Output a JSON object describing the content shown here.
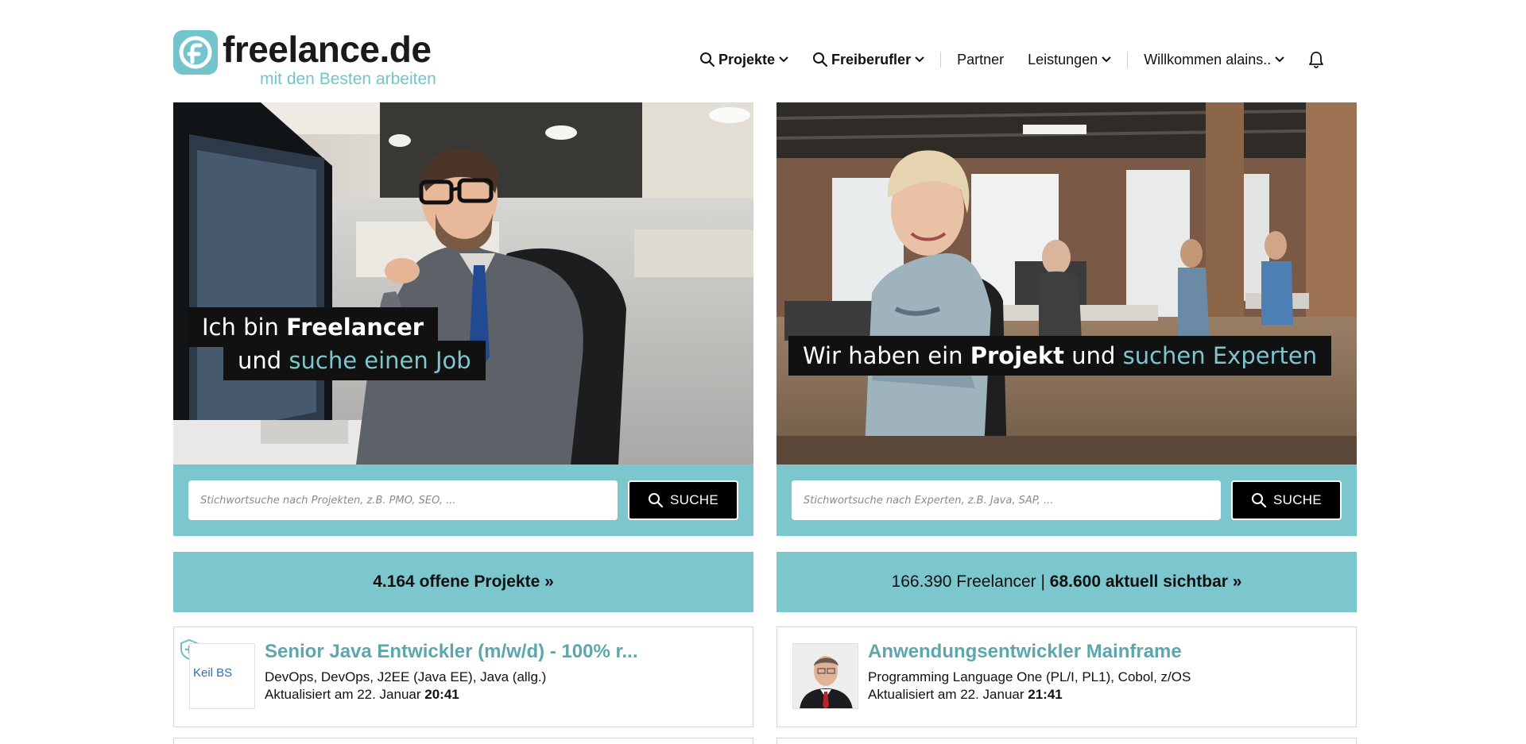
{
  "logo": {
    "name": "freelance.de",
    "tagline": "mit den Besten arbeiten"
  },
  "nav": {
    "projekte": "Projekte",
    "freiberufler": "Freiberufler",
    "partner": "Partner",
    "leistungen": "Leistungen",
    "user": "Willkommen alains.."
  },
  "left_panel": {
    "caption_line1_prefix": "Ich bin ",
    "caption_line1_bold": "Freelancer",
    "caption_line2_prefix": "und ",
    "caption_line2_accent": "suche einen Job",
    "search_placeholder": "Stichwortsuche nach Projekten, z.B. PMO, SEO, ...",
    "search_button": "SUCHE",
    "cta": "4.164 offene Projekte »"
  },
  "right_panel": {
    "caption_prefix": "Wir haben ein ",
    "caption_bold": "Projekt",
    "caption_mid": " und ",
    "caption_accent": "suchen Experten",
    "search_placeholder": "Stichwortsuche nach Experten, z.B. Java, SAP, ...",
    "search_button": "SUCHE",
    "cta_prefix": "166.390 Freelancer | ",
    "cta_bold": "68.600 aktuell sichtbar »"
  },
  "listings": {
    "left": {
      "title": "Senior Java Entwickler (m/w/d) - 100% r...",
      "skills": "DevOps, DevOps, J2EE (Java EE), Java (allg.)",
      "updated_prefix": "Aktualisiert am 22. Januar ",
      "updated_time": "20:41",
      "logo_text": "Keil BS"
    },
    "right": {
      "title": "Anwendungsentwickler Mainframe",
      "skills": "Programming Language One (PL/I, PL1), Cobol, z/OS",
      "updated_prefix": "Aktualisiert am 22. Januar ",
      "updated_time": "21:41"
    }
  },
  "colors": {
    "accent": "#7cc7ce",
    "title": "#5ca7ae",
    "logo": "#74c4cd"
  }
}
